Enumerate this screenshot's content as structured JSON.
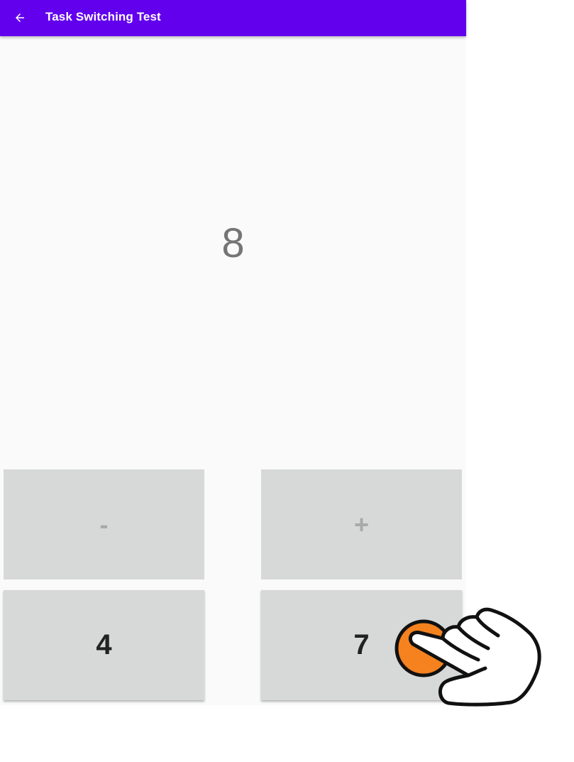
{
  "appbar": {
    "title": "Task Switching Test",
    "back_icon": "arrow-back-icon",
    "color": "#6200ee"
  },
  "stimulus": {
    "value": "8"
  },
  "buttons": {
    "minus": "-",
    "plus": "+",
    "left_number": "4",
    "right_number": "7"
  },
  "overlay": {
    "icon": "tap-hand-icon",
    "color": "#f5821f"
  }
}
